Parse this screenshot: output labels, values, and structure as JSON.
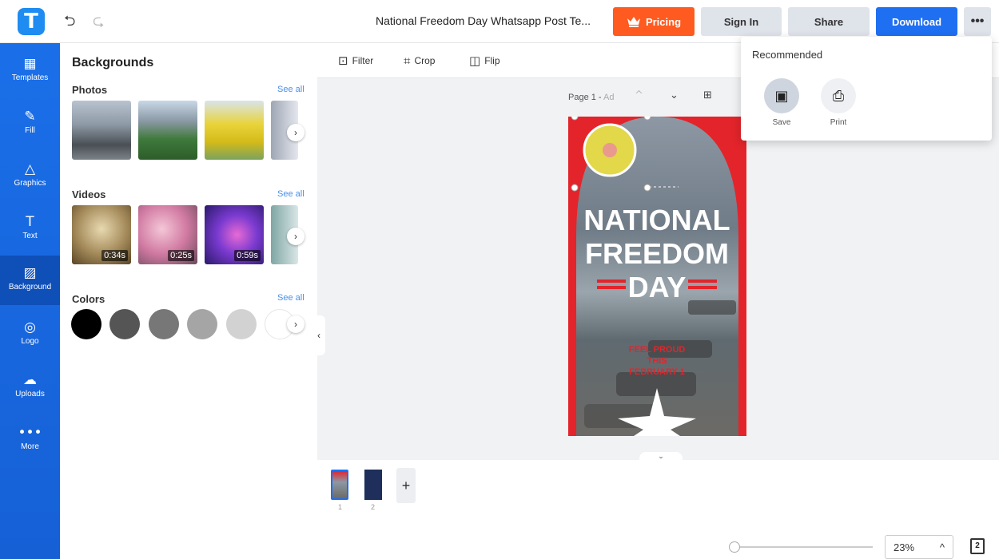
{
  "header": {
    "logo_letter": "T",
    "undo_glyph": "⮌",
    "redo_glyph": "⮎",
    "title": "National Freedom Day Whatsapp Post Te...",
    "pricing_label": "Pricing",
    "signin_label": "Sign In",
    "share_label": "Share",
    "download_label": "Download",
    "more_glyph": "•••"
  },
  "rail": {
    "items": [
      {
        "label": "Templates",
        "glyph": "▦"
      },
      {
        "label": "Fill",
        "glyph": "✎"
      },
      {
        "label": "Graphics",
        "glyph": "△"
      },
      {
        "label": "Text",
        "glyph": "T"
      },
      {
        "label": "Background",
        "glyph": "▨"
      },
      {
        "label": "Logo",
        "glyph": "◎"
      },
      {
        "label": "Uploads",
        "glyph": "☁"
      },
      {
        "label": "More",
        "glyph": "•••"
      }
    ]
  },
  "panel": {
    "title": "Backgrounds",
    "photos": {
      "label": "Photos",
      "see_all": "See all"
    },
    "videos": {
      "label": "Videos",
      "see_all": "See all",
      "durations": [
        "0:34s",
        "0:25s",
        "0:59s"
      ]
    },
    "colors": {
      "label": "Colors",
      "see_all": "See all",
      "swatches": [
        "#000000",
        "#555555",
        "#777777",
        "#a5a5a5",
        "#d2d2d2",
        "#ffffff"
      ]
    },
    "arrow_glyph": "›",
    "collapse_glyph": "‹"
  },
  "toolbar": {
    "filter_label": "Filter",
    "crop_label": "Crop",
    "flip_label": "Flip"
  },
  "page_controls": {
    "label": "Page 1 -",
    "suffix": "Ad",
    "up_glyph": "^",
    "down_glyph": "⌄",
    "add_glyph": "⊞"
  },
  "canvas": {
    "line1": "NATIONAL",
    "line2": "FREEDOM",
    "line3": "DAY",
    "tagline1": "FEEL PROUD",
    "tagline2": "THIS",
    "tagline3": "FEBRUARY 1"
  },
  "pages": {
    "numbers": [
      "1",
      "2"
    ],
    "add_glyph": "+",
    "handle_glyph": "⌄"
  },
  "zoom": {
    "value": "23%",
    "caret": "^",
    "pages_count": "2"
  },
  "popup": {
    "title": "Recommended",
    "save_label": "Save",
    "print_label": "Print",
    "save_glyph": "▣",
    "print_glyph": "⎙"
  },
  "colors": {
    "accent": "#1f6ff2",
    "pricing": "#ff5a1f",
    "rail": "#1a6fe8",
    "canvas_red": "#e3242b"
  }
}
